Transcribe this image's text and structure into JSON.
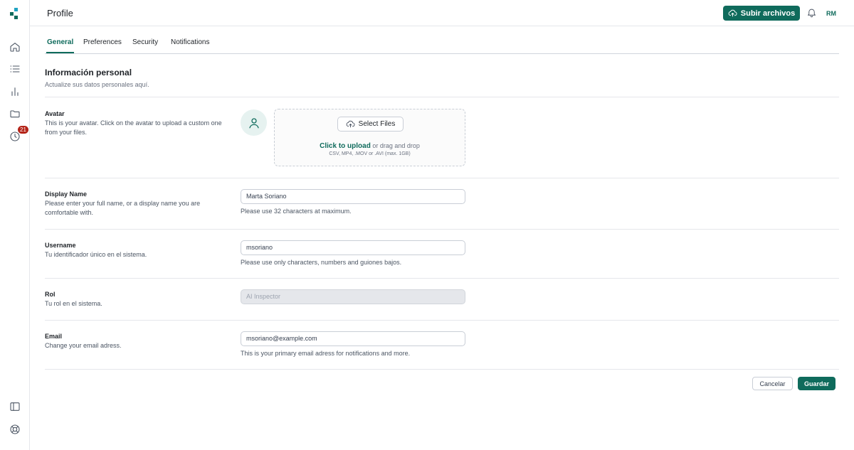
{
  "app": {
    "page_title": "Profile"
  },
  "topbar": {
    "upload_label": "Subir archivos",
    "upload_icon": "cloud-upload-icon",
    "bell_icon": "bell-icon",
    "user_initials": "RM"
  },
  "sidebar": {
    "logo": "app-logo",
    "items": [
      {
        "icon": "home-icon"
      },
      {
        "icon": "list-icon"
      },
      {
        "icon": "bar-chart-icon"
      },
      {
        "icon": "folder-icon"
      },
      {
        "icon": "clock-icon",
        "badge": "21"
      }
    ],
    "bottom": [
      {
        "icon": "sidebar-toggle-icon"
      },
      {
        "icon": "help-lifebuoy-icon"
      }
    ]
  },
  "tabs": [
    {
      "label": "General",
      "active": true
    },
    {
      "label": "Preferences"
    },
    {
      "label": "Security"
    },
    {
      "label": "Notifications"
    }
  ],
  "section": {
    "title": "Información personal",
    "subtitle": "Actualize sus datos personales aquí."
  },
  "avatar": {
    "label": "Avatar",
    "desc": "This is your avatar. Click on the avatar to upload a custom one from your files.",
    "select_files": "Select Files",
    "click_upload": "Click to upload",
    "drag_text": " or drag and drop",
    "hint": "CSV, MP4, .MOV or .AVI (max. 1GB)"
  },
  "display_name": {
    "label": "Display Name",
    "desc": "Please enter your full name, or a display name you are comfortable with.",
    "value": "Marta Soriano",
    "help": "Please use 32 characters at maximum."
  },
  "username": {
    "label": "Username",
    "desc": "Tu identificador único en el sistema.",
    "value": "msoriano",
    "help": "Please use only characters, numbers and guiones bajos."
  },
  "rol": {
    "label": "Rol",
    "desc": "Tu rol en el sistema.",
    "value": "AI Inspector"
  },
  "email": {
    "label": "Email",
    "desc": "Change your email adress.",
    "value": "msoriano@example.com",
    "help": "This is your primary email adress for notifications and more."
  },
  "actions": {
    "cancel": "Cancelar",
    "save": "Guardar"
  },
  "colors": {
    "accent": "#0f6b5c",
    "badge": "#b42318",
    "avatar_bg": "#e6f2f0"
  }
}
